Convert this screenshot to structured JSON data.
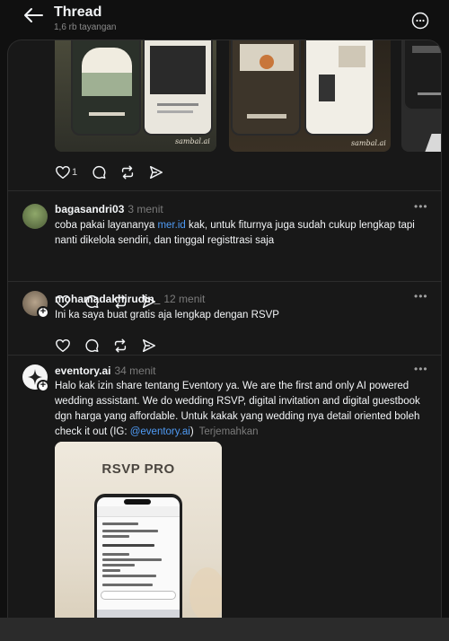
{
  "header": {
    "title": "Thread",
    "views": "1,6 rb tayangan"
  },
  "post": {
    "like_count": "1",
    "images": {
      "watermark": "sambal.ai"
    }
  },
  "replies": [
    {
      "username": "bagasandri03",
      "time": "3 menit",
      "text_before": "coba pakai layananya ",
      "link": "mer.id",
      "text_after": " kak, untuk fiturnya juga sudah cukup lengkap tapi nanti dikelola sendiri, dan tinggal registtrasi saja"
    },
    {
      "username": "mohamadakhirudin_",
      "time": "12 menit",
      "text": "Ini ka saya buat gratis aja lengkap dengan RSVP"
    },
    {
      "username": "eventory.ai",
      "time": "34 menit",
      "text_before": "Halo kak izin share tentang Eventory ya. We are the first and only AI powered wedding assistant. We do wedding RSVP, digital invitation and digital guestbook dgn harga yang affordable. Untuk kakak yang wedding nya detail oriented boleh check it out (IG: ",
      "link": "@eventory.ai",
      "text_after": ")",
      "translate": "Terjemahkan",
      "media": {
        "title": "RSVP PRO"
      }
    }
  ],
  "colors": {
    "background": "#101010",
    "card": "#181818",
    "link": "#4f9bf5",
    "muted": "#7b7b7b"
  },
  "icons": [
    "back-arrow-icon",
    "more-circle-icon",
    "heart-icon",
    "comment-icon",
    "repost-icon",
    "share-icon",
    "more-dots-icon"
  ]
}
